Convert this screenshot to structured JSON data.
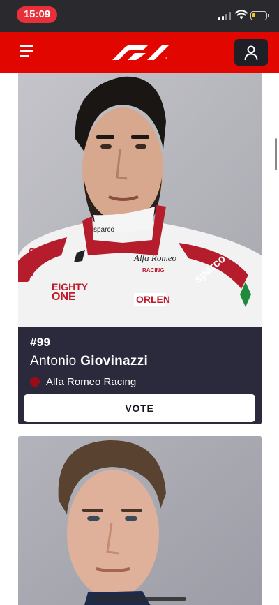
{
  "status_bar": {
    "time": "15:09",
    "icons": [
      "cellular-signal-icon",
      "wifi-icon",
      "battery-icon"
    ]
  },
  "header": {
    "brand": "F1",
    "menu_icon": "hamburger-menu-icon",
    "account_icon": "user-account-icon",
    "brand_color": "#e10600"
  },
  "drivers": [
    {
      "number": "#99",
      "first_name": "Antonio",
      "last_name": "Giovinazzi",
      "team": "Alfa Romeo Racing",
      "team_color": "#9b0c18",
      "vote_label": "VOTE"
    }
  ],
  "colors": {
    "card_background": "#2b2a3c",
    "status_time_pill": "#e8303a"
  }
}
